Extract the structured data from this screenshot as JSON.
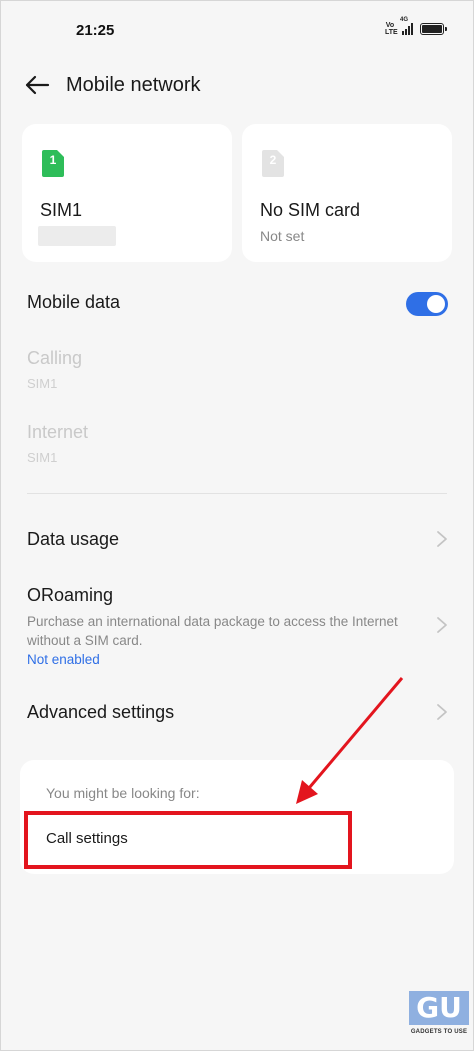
{
  "status_bar": {
    "time": "21:25",
    "volte_label": "Vo LTE",
    "network_type": "4G"
  },
  "header": {
    "title": "Mobile network"
  },
  "sim_cards": [
    {
      "slot": "1",
      "name": "SIM1",
      "status": "",
      "color": "#2ebd59"
    },
    {
      "slot": "2",
      "name": "No SIM card",
      "status": "Not set",
      "color": "#e3e3e3"
    }
  ],
  "settings": {
    "mobile_data": {
      "label": "Mobile data",
      "enabled": true
    },
    "calling": {
      "label": "Calling",
      "value": "SIM1"
    },
    "internet": {
      "label": "Internet",
      "value": "SIM1"
    },
    "data_usage": {
      "label": "Data usage"
    },
    "oroaming": {
      "label": "ORoaming",
      "description": "Purchase an international data package to access the Internet without a SIM card.",
      "status": "Not enabled"
    },
    "advanced": {
      "label": "Advanced settings"
    }
  },
  "suggestions": {
    "heading": "You might be looking for:",
    "items": [
      "Call settings"
    ]
  },
  "watermark": {
    "logo_letters": "GU",
    "text": "GADGETS TO USE"
  },
  "colors": {
    "accent": "#2f6fe6",
    "annotation_red": "#e3151e"
  }
}
